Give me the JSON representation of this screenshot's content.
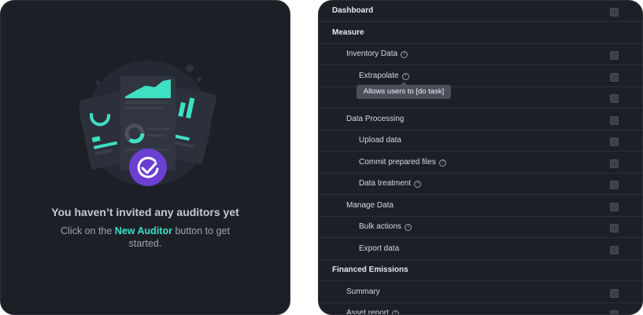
{
  "empty_state": {
    "title": "You haven’t invited any auditors yet",
    "sub_before": "Click on the ",
    "sub_highlight": "New Auditor",
    "sub_after": " button to get started."
  },
  "colors": {
    "accent_teal": "#3ee0c4",
    "accent_purple": "#6b3fd1"
  },
  "permissions": {
    "rows": [
      {
        "label": "Dashboard",
        "level": 0,
        "info": false,
        "checkbox": true
      },
      {
        "label": "Measure",
        "level": 0,
        "info": false,
        "checkbox": false
      },
      {
        "label": "Inventory Data",
        "level": 1,
        "info": true,
        "checkbox": true
      },
      {
        "label": "Extrapolate",
        "level": 2,
        "info": true,
        "checkbox": true
      },
      {
        "label": "",
        "level": 2,
        "info": false,
        "checkbox": true
      },
      {
        "label": "Data Processing",
        "level": 1,
        "info": false,
        "checkbox": true
      },
      {
        "label": "Upload data",
        "level": 2,
        "info": false,
        "checkbox": true
      },
      {
        "label": "Commit prepared files",
        "level": 2,
        "info": true,
        "checkbox": true
      },
      {
        "label": "Data treatment",
        "level": 2,
        "info": true,
        "checkbox": true
      },
      {
        "label": "Manage Data",
        "level": 1,
        "info": false,
        "checkbox": true
      },
      {
        "label": "Bulk actions",
        "level": 2,
        "info": true,
        "checkbox": true
      },
      {
        "label": "Export data",
        "level": 2,
        "info": false,
        "checkbox": true
      },
      {
        "label": "Financed Emissions",
        "level": 0,
        "info": false,
        "checkbox": false
      },
      {
        "label": "Summary",
        "level": 1,
        "info": false,
        "checkbox": true
      },
      {
        "label": "Asset report",
        "level": 1,
        "info": true,
        "checkbox": true
      }
    ],
    "tooltip": "Allows users to [do task]"
  }
}
